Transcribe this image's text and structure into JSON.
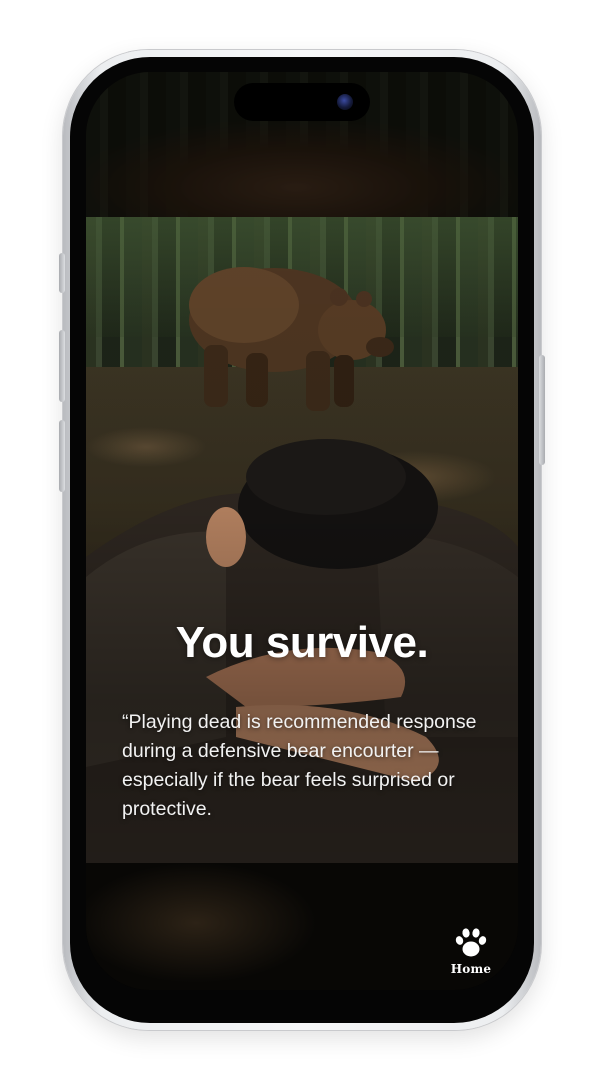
{
  "post": {
    "headline": "You survive.",
    "quote": "“Playing dead is recommended response during a defensive bear encourter — especially if the bear feels surprised or protective."
  },
  "nav": {
    "home_label": "Home",
    "home_icon": "paw-icon"
  },
  "colors": {
    "text": "#ffffff",
    "background": "#070604"
  }
}
